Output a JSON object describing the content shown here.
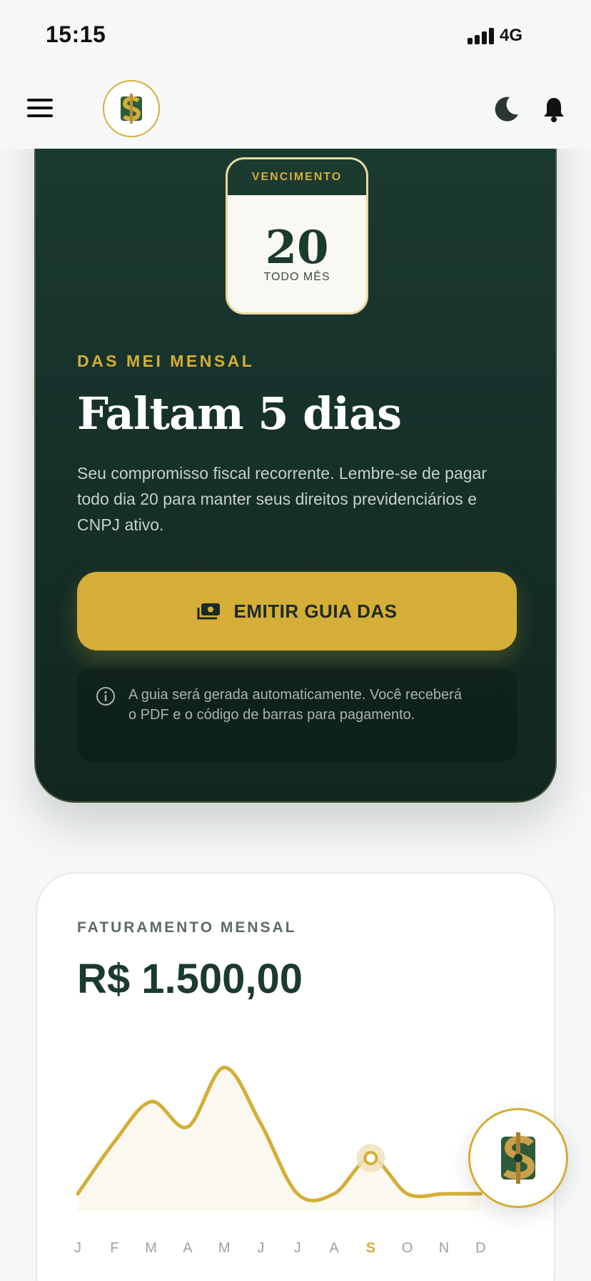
{
  "status_bar": {
    "time": "15:15",
    "network": "4G"
  },
  "header": {
    "menu_icon": "hamburger-icon",
    "logo_icon": "dollar-logo-icon",
    "theme_icon": "moon-icon",
    "notification_icon": "bell-icon"
  },
  "das_card": {
    "calendar_header": "VENCIMENTO",
    "calendar_day": "20",
    "calendar_sub": "TODO MÊS",
    "eyebrow": "DAS MEI MENSAL",
    "title": "Faltam 5 dias",
    "description": "Seu compromisso fiscal recorrente. Lembre-se de pagar todo dia 20 para manter seus direitos previdenciários e CNPJ ativo.",
    "button_label": "EMITIR GUIA DAS",
    "button_icon": "money-icon",
    "info_icon": "info-icon",
    "info_text": "A guia será gerada automaticamente. Você receberá o PDF e o código de barras para pagamento."
  },
  "revenue_card": {
    "eyebrow": "FATURAMENTO MENSAL",
    "value": "R$ 1.500,00"
  },
  "chart_data": {
    "type": "line",
    "categories": [
      "J",
      "F",
      "M",
      "A",
      "M",
      "J",
      "J",
      "A",
      "S",
      "O",
      "N",
      "D"
    ],
    "values": [
      0,
      0.35,
      0.62,
      0.45,
      0.85,
      0.47,
      0,
      0,
      0.24,
      0,
      0,
      0
    ],
    "selected_index": 8,
    "grid": false
  },
  "colors": {
    "primary_dark": "#1b3a30",
    "accent_gold": "#d4ae37",
    "background": "#f6f7f8"
  },
  "fab": {
    "icon": "dollar-logo-icon"
  }
}
